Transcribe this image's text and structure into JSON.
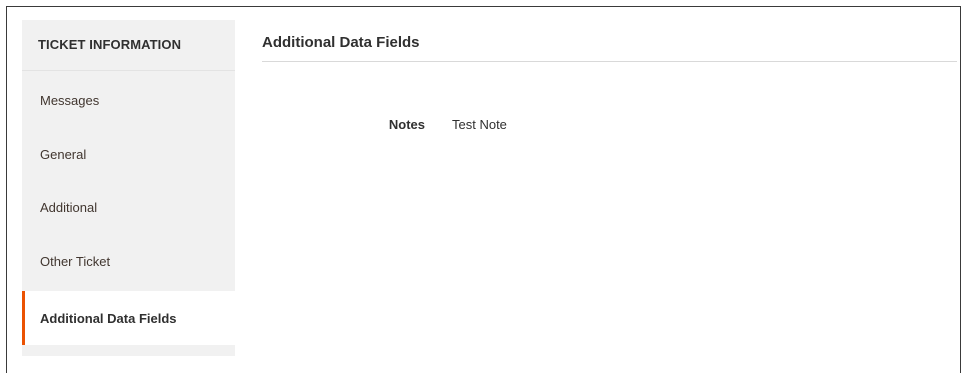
{
  "sidebar": {
    "title": "TICKET INFORMATION",
    "tabs": [
      {
        "label": "Messages",
        "active": false
      },
      {
        "label": "General",
        "active": false
      },
      {
        "label": "Additional",
        "active": false
      },
      {
        "label": "Other Ticket",
        "active": false
      },
      {
        "label": "Additional Data Fields",
        "active": true
      }
    ]
  },
  "main": {
    "section_title": "Additional Data Fields",
    "fields": [
      {
        "label": "Notes",
        "value": "Test Note"
      }
    ]
  },
  "colors": {
    "accent": "#eb5202",
    "sidebar_bg": "#f1f1f1"
  }
}
